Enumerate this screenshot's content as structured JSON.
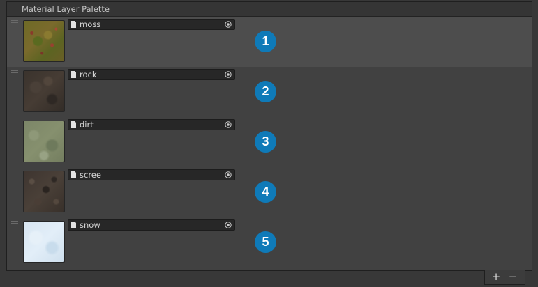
{
  "panel": {
    "title": "Material Layer Palette"
  },
  "layers": [
    {
      "name": "moss",
      "badge": "1",
      "selected": true,
      "texture": "moss-texture"
    },
    {
      "name": "rock",
      "badge": "2",
      "selected": false,
      "texture": "rock-texture"
    },
    {
      "name": "dirt",
      "badge": "3",
      "selected": false,
      "texture": "dirt-texture"
    },
    {
      "name": "scree",
      "badge": "4",
      "selected": false,
      "texture": "scree-texture"
    },
    {
      "name": "snow",
      "badge": "5",
      "selected": false,
      "texture": "snow-texture"
    }
  ],
  "footer": {
    "add_label": "+",
    "remove_label": "−"
  },
  "colors": {
    "panel_bg": "#414141",
    "selected_row": "#4d4d4d",
    "badge": "#0f7ab8",
    "field_bg": "#272727"
  },
  "icons": {
    "field_icon": "file-icon",
    "picker_icon": "object-picker-icon",
    "drag_icon": "drag-handle-icon"
  }
}
